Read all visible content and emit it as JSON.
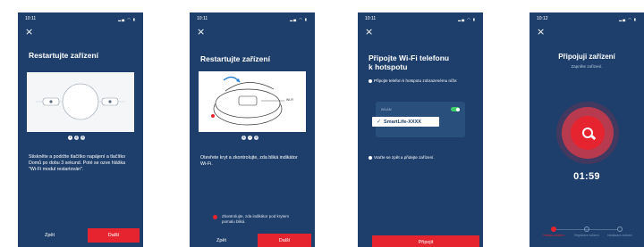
{
  "colors": {
    "background": "#1e3f6b",
    "accent": "#e5242f",
    "toggle_on": "#3ecf6a"
  },
  "screen1": {
    "time": "10:11",
    "title": "Restartujte zařízení",
    "dots": [
      "1",
      "2",
      "3"
    ],
    "instruction": "Stiskněte a podržte tlačítko napájení a tlačítko Domů po dobu 3 sekund. Poté se ozve hláška \"Wi-Fi modul restartován\".",
    "back_label": "Zpět",
    "next_label": "Další"
  },
  "screen2": {
    "time": "10:11",
    "title": "Restartujte zařízení",
    "robot_label": "Wi-Fi",
    "dots": [
      "1",
      "2",
      "3"
    ],
    "instruction": "Otevřete kryt a zkontrolujte, zda bliká indikátor Wi-Fi.",
    "led_note": "Zkontrolujte, zda indikátor pod krytem pomalu bliká.",
    "back_label": "Zpět",
    "next_label": "Další"
  },
  "screen3": {
    "time": "10:11",
    "title_line1": "Připojte Wi-Fi telefonu",
    "title_line2": "k hotspotu",
    "instruction1": "Připojte telefon k hotspotu zobrazenému níže:",
    "wifi_label": "WLAN",
    "network_name": "SmartLife-XXXX",
    "instruction2": "Vraťte se zpět a přidejte zařízení.",
    "connect_label": "Připojit"
  },
  "screen4": {
    "time": "10:12",
    "title": "Připojuji zařízení",
    "subtitle": "Zapněte zařízení.",
    "timer": "01:59",
    "steps": [
      "Hledání zařízení",
      "Registrace zařízení",
      "Inicializace zařízení"
    ]
  }
}
